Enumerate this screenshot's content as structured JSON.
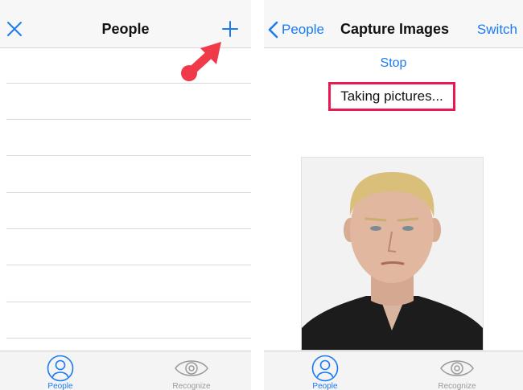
{
  "left": {
    "nav": {
      "title": "People",
      "close_icon": "close-icon",
      "add_icon": "plus-icon"
    },
    "annotation_icon": "pointer-arrow-icon",
    "list_rows": 8,
    "tabs": [
      {
        "label": "People",
        "icon": "person-circle-icon",
        "active": true
      },
      {
        "label": "Recognize",
        "icon": "eye-icon",
        "active": false
      }
    ]
  },
  "right": {
    "nav": {
      "back_label": "People",
      "title": "Capture Images",
      "switch_label": "Switch"
    },
    "stop_label": "Stop",
    "status_text": "Taking pictures...",
    "tabs": [
      {
        "label": "People",
        "icon": "person-circle-icon",
        "active": true
      },
      {
        "label": "Recognize",
        "icon": "eye-icon",
        "active": false
      }
    ]
  },
  "colors": {
    "accent": "#1a7bf2",
    "highlight": "#e8194f",
    "arrow": "#f03a4a"
  }
}
